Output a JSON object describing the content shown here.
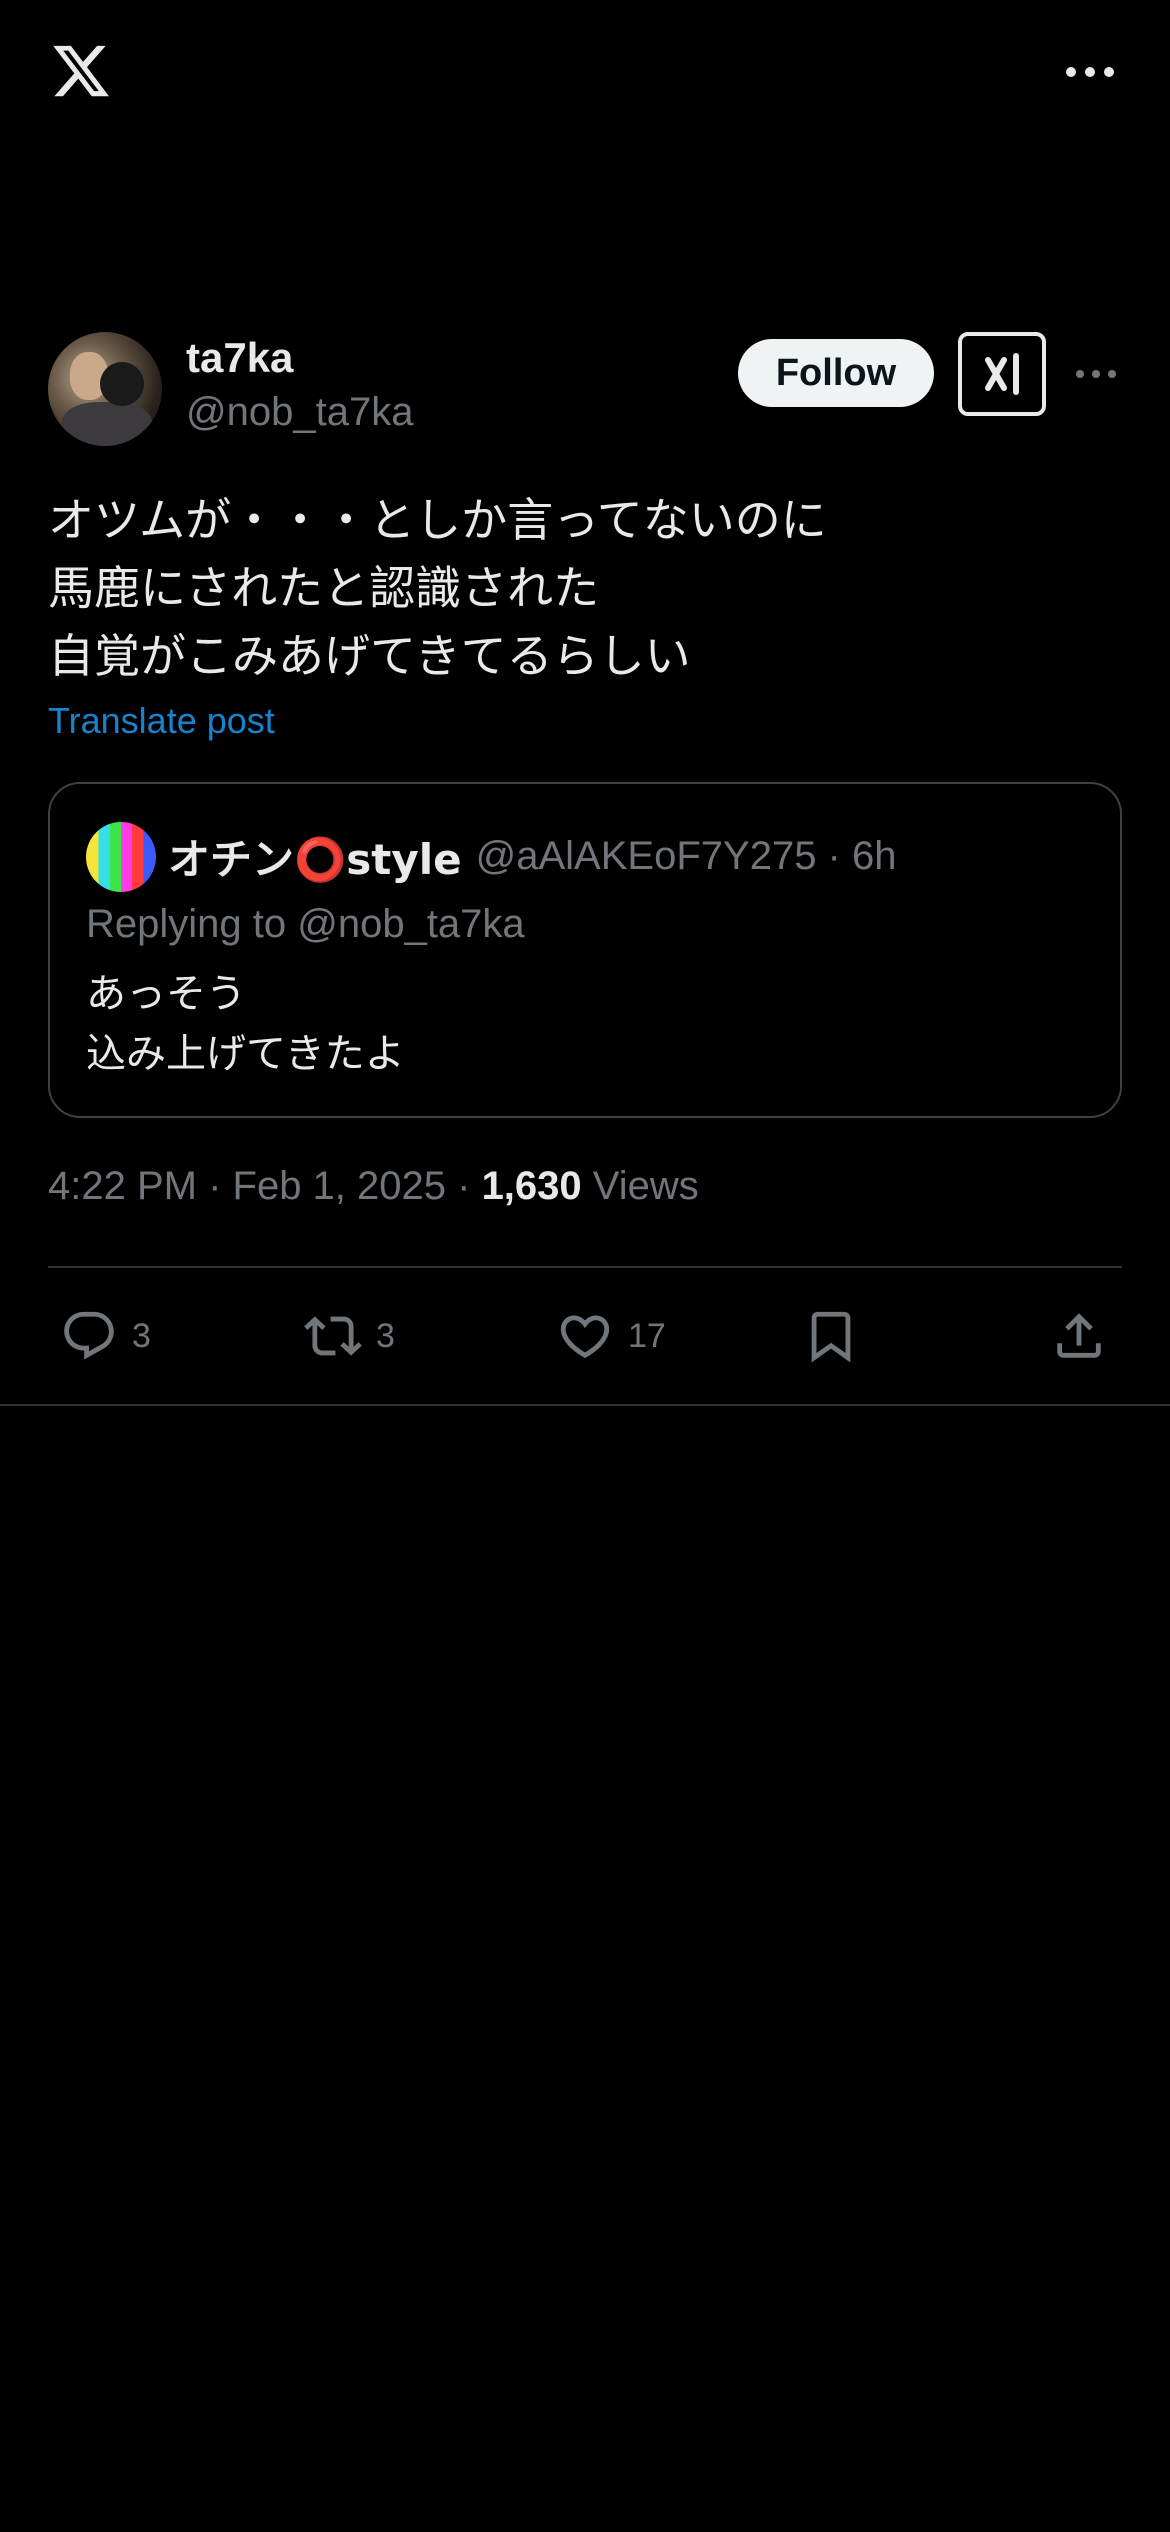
{
  "topbar": {
    "logo_icon": "x-logo-icon",
    "more_icon": "more-horizontal-icon"
  },
  "post": {
    "author": {
      "display_name": "ta7ka",
      "handle": "@nob_ta7ka"
    },
    "follow_label": "Follow",
    "grok_icon": "grok-icon",
    "more_icon": "more-horizontal-icon",
    "text_lines": [
      "オツムが・・・としか言ってないのに",
      "馬鹿にされたと認識された",
      "自覚がこみあげてきてるらしい"
    ],
    "translate_label": "Translate post",
    "timestamp": "4:22 PM · Feb 1, 2025 · ",
    "views_count": "1,630",
    "views_label": " Views"
  },
  "quote": {
    "display_name": "オチン⭕style",
    "handle_time": "@aAlAKEoF7Y275 · 6h",
    "replying_to": "Replying to @nob_ta7ka",
    "text_lines": [
      "あっそう",
      "込み上げてきたよ"
    ]
  },
  "actions": {
    "reply_count": "3",
    "repost_count": "3",
    "like_count": "17",
    "icons": [
      "reply-icon",
      "repost-icon",
      "like-icon",
      "bookmark-icon",
      "share-icon"
    ]
  },
  "colors": {
    "background": "#000000",
    "text": "#e7e9ea",
    "muted": "#71767b",
    "link": "#1d9bf0",
    "border": "#2f3336"
  }
}
